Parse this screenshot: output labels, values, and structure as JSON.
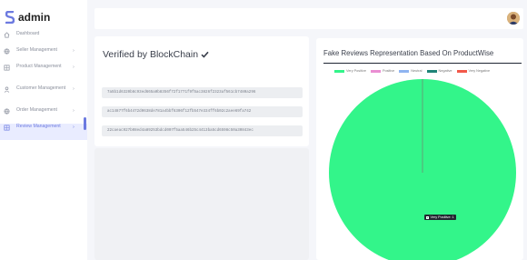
{
  "brand": {
    "name": "admin"
  },
  "sidebar": {
    "items": [
      {
        "label": "Dashboard",
        "icon": "home-icon",
        "chevron": ""
      },
      {
        "label": "Seller Management",
        "icon": "globe-icon",
        "chevron": "›"
      },
      {
        "label": "Product Management",
        "icon": "grid-icon",
        "chevron": "›"
      },
      {
        "label": "Customer Management",
        "icon": "user-icon",
        "chevron": "›"
      },
      {
        "label": "Order Management",
        "icon": "globe-icon",
        "chevron": "›"
      },
      {
        "label": "Review Management",
        "icon": "grid-icon",
        "chevron": "›"
      }
    ],
    "active_index": 5,
    "accent": "#6c7ae0"
  },
  "blockchain": {
    "title": "Verified by BlockChain",
    "hashes": [
      "7a5b1d6320b8c93ed665a0b8356f72f1771f9f5ac3826f2323af561cb7480a296",
      "ac14877f6b4472d0638de781a4bbf6306f12fb547e334ff6b02c2aee69fa742",
      "22caeac927b08ed4a89253bdcd007f5aa546b25c4413ba5cd6598c50a30843ec"
    ]
  },
  "chart_data": {
    "type": "pie",
    "title": "Fake Reviews Representation Based On ProductWise",
    "legend_position": "top",
    "series": [
      {
        "name": "Very Positive",
        "value": 1,
        "color": "#33f58a"
      },
      {
        "name": "Positive",
        "value": 0,
        "color": "#ea8ed2"
      },
      {
        "name": "Neutral",
        "value": 0,
        "color": "#8fb4f0"
      },
      {
        "name": "Negative",
        "value": 0,
        "color": "#1f8478"
      },
      {
        "name": "Very Negative",
        "value": 0,
        "color": "#f2584a"
      }
    ],
    "tooltip": {
      "series": "Very Positive",
      "value": "1",
      "text": "Very Positive: 1"
    }
  }
}
